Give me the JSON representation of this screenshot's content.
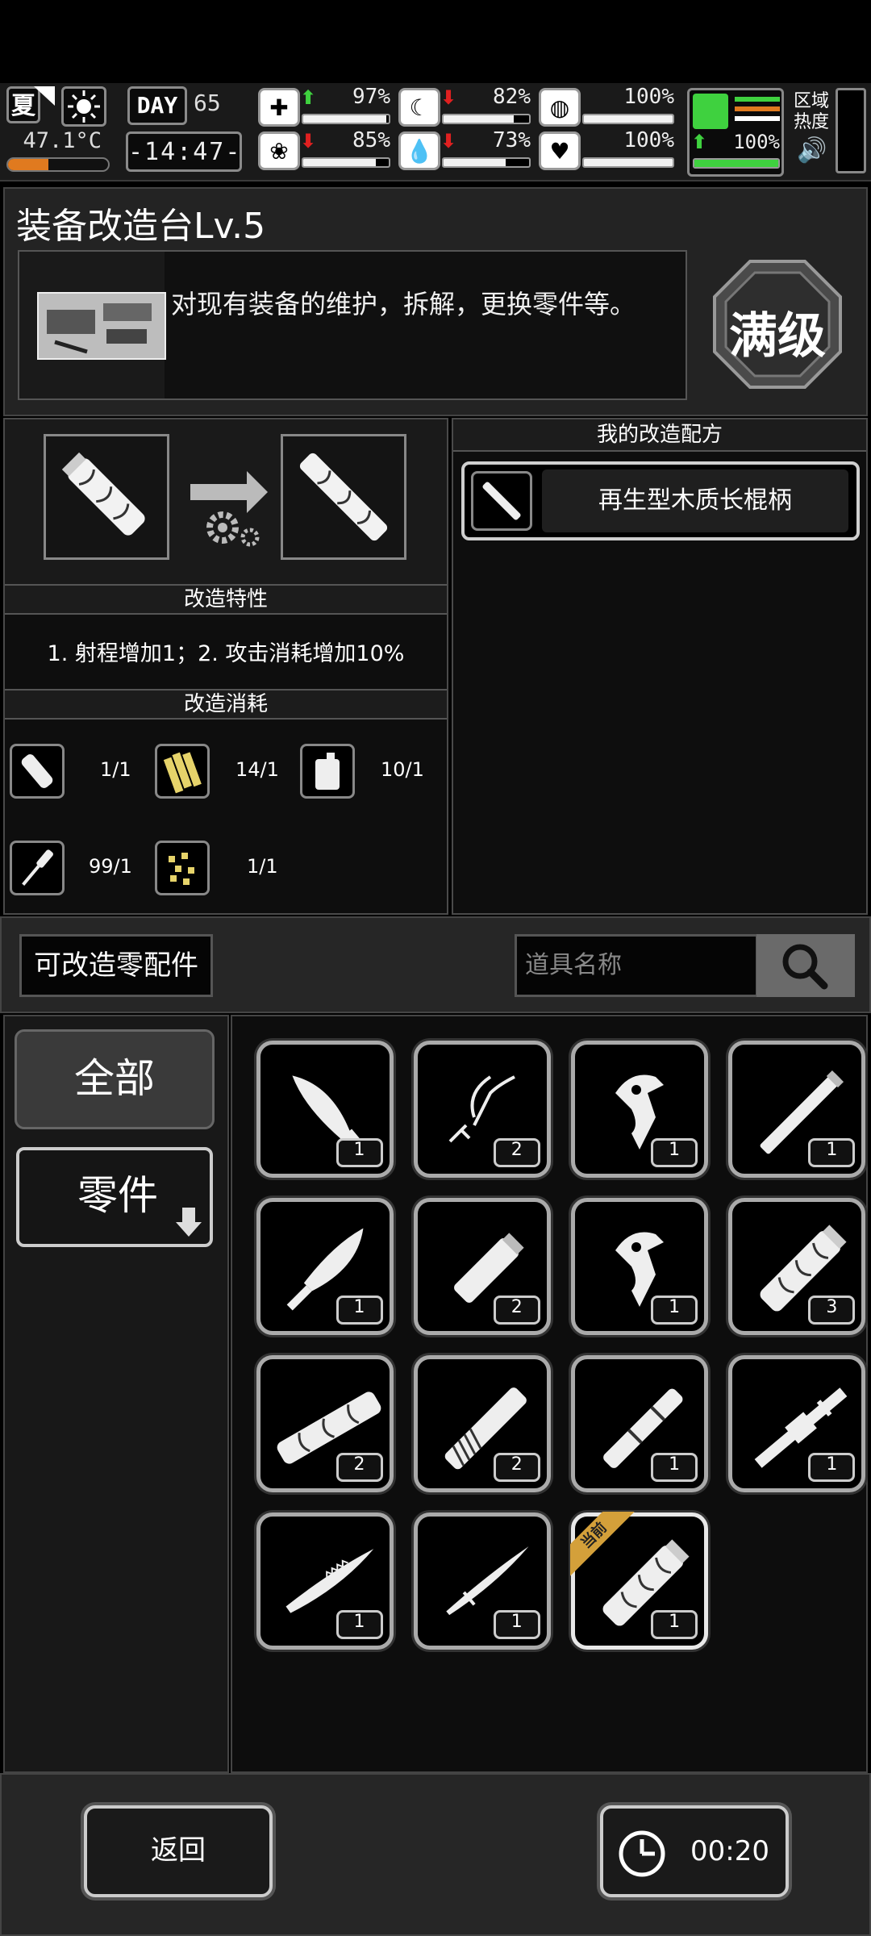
{
  "status": {
    "season": "夏",
    "temperature": "47.1°C",
    "temperature_level": 0.4,
    "day_label": "DAY",
    "day_number": "65",
    "clock": "-14:47-",
    "stats": [
      {
        "name": "health",
        "icon": "medkit-icon",
        "trend": "up",
        "value": "97%",
        "level": 0.97
      },
      {
        "name": "hunger",
        "icon": "stomach-icon",
        "trend": "down",
        "value": "82%",
        "level": 0.82
      },
      {
        "name": "armor",
        "icon": "shield-icon",
        "trend": "",
        "value": "100%",
        "level": 1.0
      },
      {
        "name": "sanity",
        "icon": "brain-icon",
        "trend": "down",
        "value": "85%",
        "level": 0.85
      },
      {
        "name": "thirst",
        "icon": "water-drop-icon",
        "trend": "down",
        "value": "73%",
        "level": 0.73
      },
      {
        "name": "mood",
        "icon": "heart-icon",
        "trend": "",
        "value": "100%",
        "level": 1.0
      },
      {
        "name": "stamina",
        "icon": "boot-icon",
        "trend": "up",
        "value": "100%",
        "level": 1.0
      }
    ],
    "zone_heat_label": "区域热度"
  },
  "header": {
    "title": "装备改造台Lv.5",
    "description": "对现有装备的维护，拆解，更换零件等。",
    "max_level": "满级"
  },
  "modify": {
    "traits_title": "改造特性",
    "traits_text": "1. 射程增加1；2. 攻击消耗增加10%",
    "cost_title": "改造消耗",
    "materials": [
      {
        "icon": "bandage-icon",
        "value": "1/1"
      },
      {
        "icon": "wood-planks-icon",
        "value": "14/1"
      },
      {
        "icon": "fuel-can-icon",
        "value": "10/1"
      },
      {
        "icon": "screwdriver-icon",
        "value": "99/1"
      },
      {
        "icon": "screws-icon",
        "value": "1/1"
      }
    ]
  },
  "recipes": {
    "title": "我的改造配方",
    "items": [
      {
        "name": "再生型木质长棍柄"
      }
    ]
  },
  "parts": {
    "label": "可改造零配件",
    "search_placeholder": "道具名称",
    "tabs": {
      "all": "全部",
      "parts": "零件"
    },
    "items": [
      {
        "icon": "blade-icon",
        "count": "1"
      },
      {
        "icon": "wire-parts-icon",
        "count": "2"
      },
      {
        "icon": "trigger-icon",
        "count": "1"
      },
      {
        "icon": "stick-icon",
        "count": "1"
      },
      {
        "icon": "machete-blade-icon",
        "count": "1"
      },
      {
        "icon": "short-handle-icon",
        "count": "2"
      },
      {
        "icon": "trigger-icon",
        "count": "1"
      },
      {
        "icon": "wood-handle-icon",
        "count": "3"
      },
      {
        "icon": "long-wood-handle-icon",
        "count": "2"
      },
      {
        "icon": "wrapped-handle-icon",
        "count": "2"
      },
      {
        "icon": "grip-handle-icon",
        "count": "1"
      },
      {
        "icon": "rod-handle-icon",
        "count": "1"
      },
      {
        "icon": "saw-blade-icon",
        "count": "1"
      },
      {
        "icon": "katana-blade-icon",
        "count": "1"
      },
      {
        "icon": "wood-handle-icon",
        "count": "1",
        "current": true,
        "badge": "当前"
      }
    ]
  },
  "footer": {
    "back": "返回",
    "timer": "00:20"
  }
}
